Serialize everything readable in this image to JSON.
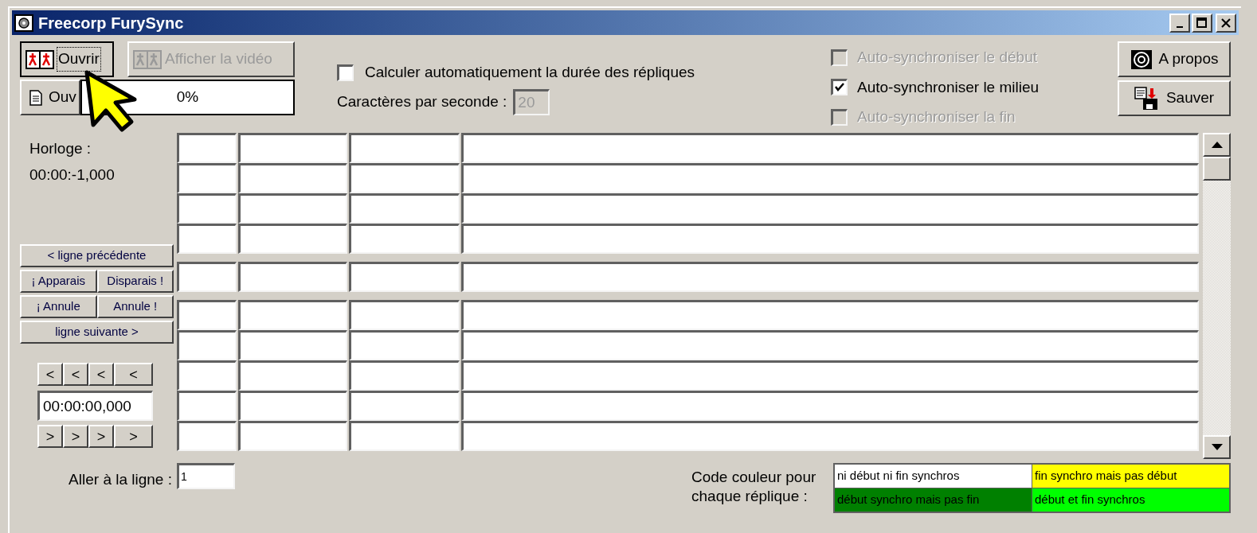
{
  "window": {
    "title": "Freecorp FurySync"
  },
  "toolbar": {
    "buttons": [
      {
        "label": "Ouvrir",
        "disabled": false,
        "focused": true
      },
      {
        "label": "Afficher la vidéo",
        "disabled": true,
        "focused": false
      }
    ],
    "second_button": {
      "label": "Ouv"
    },
    "progress": {
      "text": "0%",
      "level": 0
    }
  },
  "auto_duration": {
    "label": "Calculer automatiquement la durée des répliques",
    "checked": false
  },
  "chars_per_second": {
    "label": "Caractères par seconde :",
    "value": "20",
    "disabled": true
  },
  "sync_options": [
    {
      "label": "Auto-synchroniser le début",
      "checked": false,
      "disabled": true
    },
    {
      "label": "Auto-synchroniser le milieu",
      "checked": true,
      "disabled": false
    },
    {
      "label": "Auto-synchroniser la fin",
      "checked": false,
      "disabled": true
    }
  ],
  "side_buttons": [
    {
      "label": "A propos",
      "kind": "about"
    },
    {
      "label": "Sauver",
      "kind": "save"
    }
  ],
  "clock": {
    "label": "Horloge :",
    "value": "00:00:-1,000"
  },
  "nav_buttons": [
    [
      {
        "label": "< ligne précédente"
      }
    ],
    [
      {
        "label": "¡ Apparais"
      },
      {
        "label": "Disparais !"
      }
    ],
    [
      {
        "label": "¡ Annule"
      },
      {
        "label": "Annule !"
      }
    ],
    [
      {
        "label": "ligne suivante >"
      }
    ]
  ],
  "step_back_buttons": [
    "<",
    "<",
    "<",
    "<"
  ],
  "time_field": {
    "value": "00:00:00,000"
  },
  "step_forward_buttons": [
    ">",
    ">",
    ">",
    ">"
  ],
  "goto_line": {
    "label": "Aller à la ligne :",
    "value": "1"
  },
  "color_legend": {
    "label": "Code couleur pour chaque réplique :",
    "items": [
      {
        "label": "ni début ni fin synchros",
        "color": "#ffffff"
      },
      {
        "label": "fin synchro mais pas début",
        "color": "#ffff00"
      },
      {
        "label": "début synchro mais pas fin",
        "color": "#008000"
      },
      {
        "label": "début et fin synchros",
        "color": "#00ff00"
      }
    ]
  }
}
